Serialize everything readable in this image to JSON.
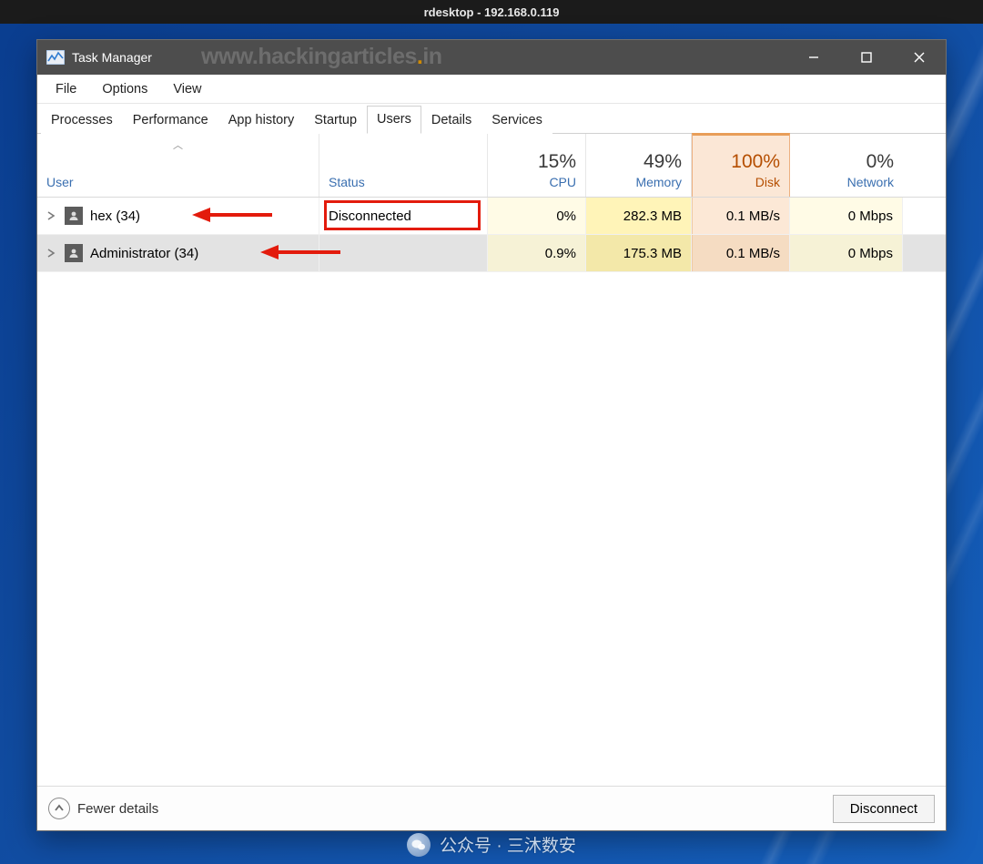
{
  "outer_title": "rdesktop - 192.168.0.119",
  "window": {
    "title": "Task Manager",
    "watermark_pre": "www.hackingarticles",
    "watermark_dot": ".",
    "watermark_post": "in"
  },
  "menu": {
    "file": "File",
    "options": "Options",
    "view": "View"
  },
  "tabs": {
    "processes": "Processes",
    "performance": "Performance",
    "apphistory": "App history",
    "startup": "Startup",
    "users": "Users",
    "details": "Details",
    "services": "Services"
  },
  "headers": {
    "user": "User",
    "status": "Status",
    "cpu_pct": "15%",
    "cpu_lbl": "CPU",
    "mem_pct": "49%",
    "mem_lbl": "Memory",
    "disk_pct": "100%",
    "disk_lbl": "Disk",
    "net_pct": "0%",
    "net_lbl": "Network"
  },
  "rows": [
    {
      "name": "hex (34)",
      "status": "Disconnected",
      "cpu": "0%",
      "mem": "282.3 MB",
      "disk": "0.1 MB/s",
      "net": "0 Mbps"
    },
    {
      "name": "Administrator (34)",
      "status": "",
      "cpu": "0.9%",
      "mem": "175.3 MB",
      "disk": "0.1 MB/s",
      "net": "0 Mbps"
    }
  ],
  "footer": {
    "fewer": "Fewer details",
    "disconnect": "Disconnect"
  },
  "bottom_watermark": "公众号 · 三沐数安"
}
